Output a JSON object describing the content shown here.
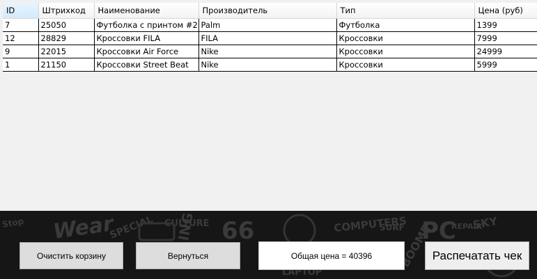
{
  "grid": {
    "columns": [
      "ID",
      "Штрихкод",
      "Наименование",
      "Производитель",
      "Тип",
      "Цена (руб)"
    ],
    "rows": [
      [
        "7",
        "25050",
        "Футболка с принтом #2",
        "Palm",
        "Футболка",
        "1399"
      ],
      [
        "12",
        "28829",
        "Кроссовки FILA",
        "FILA",
        "Кроссовки",
        "7999"
      ],
      [
        "9",
        "22015",
        "Кроссовки Air Force",
        "Nike",
        "Кроссовки",
        "24999"
      ],
      [
        "1",
        "21150",
        "Кроссовки Street Beat",
        "Nike",
        "Кроссовки",
        "5999"
      ]
    ]
  },
  "actions": {
    "clear_cart": "Очистить корзину",
    "back": "Вернуться",
    "total": "Общая цена = 40396",
    "print": "Распечатать чек"
  },
  "background": {
    "words": [
      "Wear",
      "SPECIAL",
      "CULTURE",
      "COMPUTERS",
      "SURF",
      "PC",
      "REPAIR",
      "SKY",
      "BOOME",
      "LAPTOP",
      "66",
      "ING",
      "Stop"
    ]
  },
  "colors": {
    "panel_bg": "#161616",
    "grid_bg": "#f0f0f0",
    "selected_header": "#d9ebfa"
  }
}
